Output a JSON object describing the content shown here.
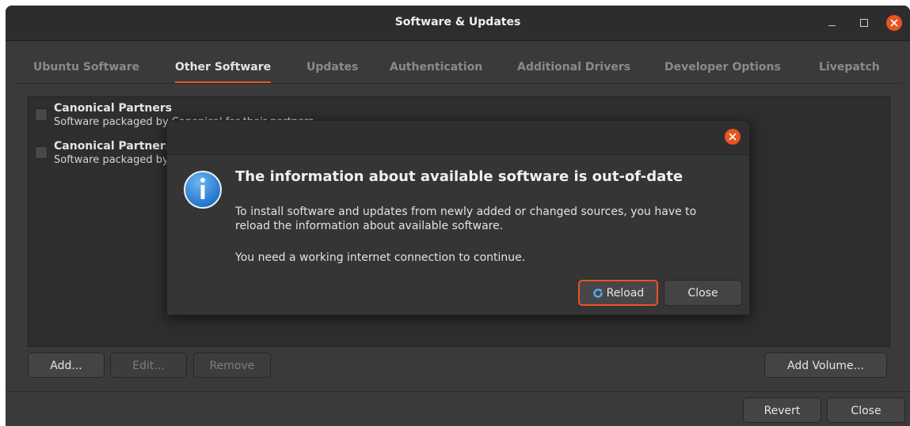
{
  "window": {
    "title": "Software & Updates"
  },
  "tabs": [
    {
      "label": "Ubuntu Software"
    },
    {
      "label": "Other Software"
    },
    {
      "label": "Updates"
    },
    {
      "label": "Authentication"
    },
    {
      "label": "Additional Drivers"
    },
    {
      "label": "Developer Options"
    },
    {
      "label": "Livepatch"
    }
  ],
  "sources": [
    {
      "name": "Canonical Partners",
      "desc": "Software packaged by Canonical for their partners"
    },
    {
      "name": "Canonical Partners",
      "desc": "Software packaged by Canonical for their partners"
    }
  ],
  "list_buttons": {
    "add": "Add...",
    "edit": "Edit...",
    "remove": "Remove",
    "add_volume": "Add Volume..."
  },
  "footer_buttons": {
    "revert": "Revert",
    "close": "Close"
  },
  "dialog": {
    "title": "The information about available software is out-of-date",
    "message": "To install software and updates from newly added or changed sources, you have to reload the information about available software.",
    "note": "You need a working internet connection to continue.",
    "reload_label": "Reload",
    "close_label": "Close"
  },
  "colors": {
    "accent": "#e95420",
    "info_blue": "#2f86d8"
  }
}
